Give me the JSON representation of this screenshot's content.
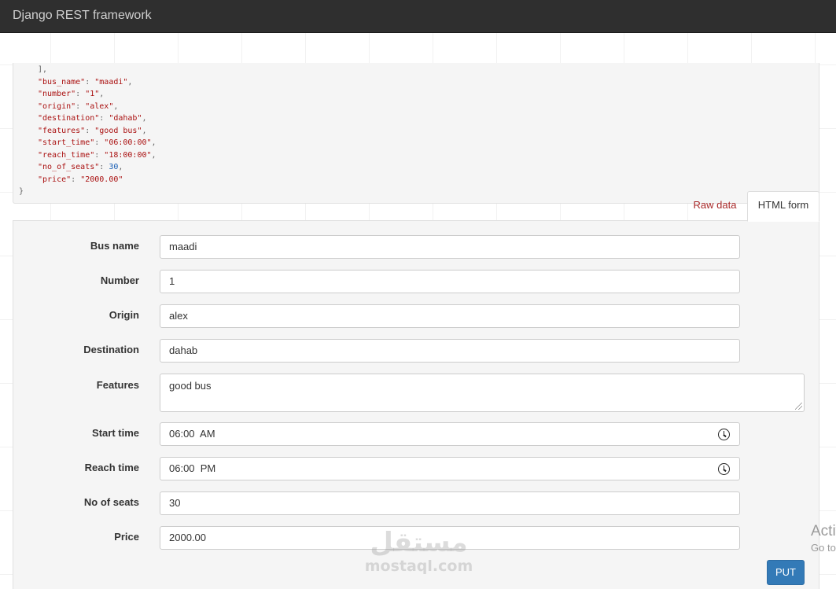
{
  "navbar": {
    "brand": "Django REST framework"
  },
  "response": {
    "lines": [
      {
        "indent": "    ",
        "parts": [
          {
            "t": "punc",
            "v": "],"
          }
        ]
      },
      {
        "indent": "    ",
        "parts": [
          {
            "t": "key",
            "v": "\"bus_name\""
          },
          {
            "t": "punc",
            "v": ": "
          },
          {
            "t": "str",
            "v": "\"maadi\""
          },
          {
            "t": "punc",
            "v": ","
          }
        ]
      },
      {
        "indent": "    ",
        "parts": [
          {
            "t": "key",
            "v": "\"number\""
          },
          {
            "t": "punc",
            "v": ": "
          },
          {
            "t": "str",
            "v": "\"1\""
          },
          {
            "t": "punc",
            "v": ","
          }
        ]
      },
      {
        "indent": "    ",
        "parts": [
          {
            "t": "key",
            "v": "\"origin\""
          },
          {
            "t": "punc",
            "v": ": "
          },
          {
            "t": "str",
            "v": "\"alex\""
          },
          {
            "t": "punc",
            "v": ","
          }
        ]
      },
      {
        "indent": "    ",
        "parts": [
          {
            "t": "key",
            "v": "\"destination\""
          },
          {
            "t": "punc",
            "v": ": "
          },
          {
            "t": "str",
            "v": "\"dahab\""
          },
          {
            "t": "punc",
            "v": ","
          }
        ]
      },
      {
        "indent": "    ",
        "parts": [
          {
            "t": "key",
            "v": "\"features\""
          },
          {
            "t": "punc",
            "v": ": "
          },
          {
            "t": "str",
            "v": "\"good bus\""
          },
          {
            "t": "punc",
            "v": ","
          }
        ]
      },
      {
        "indent": "    ",
        "parts": [
          {
            "t": "key",
            "v": "\"start_time\""
          },
          {
            "t": "punc",
            "v": ": "
          },
          {
            "t": "str",
            "v": "\"06:00:00\""
          },
          {
            "t": "punc",
            "v": ","
          }
        ]
      },
      {
        "indent": "    ",
        "parts": [
          {
            "t": "key",
            "v": "\"reach_time\""
          },
          {
            "t": "punc",
            "v": ": "
          },
          {
            "t": "str",
            "v": "\"18:00:00\""
          },
          {
            "t": "punc",
            "v": ","
          }
        ]
      },
      {
        "indent": "    ",
        "parts": [
          {
            "t": "key",
            "v": "\"no_of_seats\""
          },
          {
            "t": "punc",
            "v": ": "
          },
          {
            "t": "num",
            "v": "30"
          },
          {
            "t": "punc",
            "v": ","
          }
        ]
      },
      {
        "indent": "    ",
        "parts": [
          {
            "t": "key",
            "v": "\"price\""
          },
          {
            "t": "punc",
            "v": ": "
          },
          {
            "t": "str",
            "v": "\"2000.00\""
          }
        ]
      },
      {
        "indent": "",
        "parts": [
          {
            "t": "punc",
            "v": "}"
          }
        ]
      }
    ]
  },
  "tabs": {
    "raw": "Raw data",
    "html": "HTML form"
  },
  "form": {
    "bus_name": {
      "label": "Bus name",
      "value": "maadi"
    },
    "number": {
      "label": "Number",
      "value": "1"
    },
    "origin": {
      "label": "Origin",
      "value": "alex"
    },
    "destination": {
      "label": "Destination",
      "value": "dahab"
    },
    "features": {
      "label": "Features",
      "value": "good bus"
    },
    "start_time": {
      "label": "Start time",
      "value": "06:00  AM"
    },
    "reach_time": {
      "label": "Reach time",
      "value": "06:00  PM"
    },
    "no_of_seats": {
      "label": "No of seats",
      "value": "30"
    },
    "price": {
      "label": "Price",
      "value": "2000.00"
    },
    "submit": "PUT"
  },
  "watermark": {
    "arabic": "مستقل",
    "latin": "mostaql.com"
  },
  "os_overlay": {
    "line1": "Activate Windows",
    "line2": "Go to Settings to activate Windows."
  },
  "colors": {
    "navbar": "#2f2f2f",
    "primary_button": "#337ab7",
    "json_key": "#aa1111",
    "json_number": "#1a5fb4",
    "tab_link": "#a82828"
  }
}
